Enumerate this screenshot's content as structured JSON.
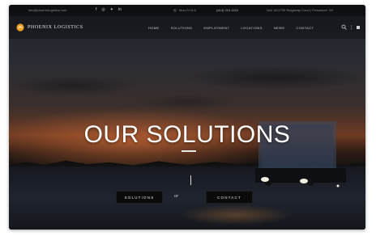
{
  "topbar": {
    "email": "info@phoenixlogistics.com",
    "social": [
      {
        "icon": "facebook-icon",
        "glyph": "f"
      },
      {
        "icon": "instagram-icon",
        "glyph": "◎"
      },
      {
        "icon": "twitter-icon",
        "glyph": "✦"
      },
      {
        "icon": "linkedin-icon",
        "glyph": "in"
      }
    ],
    "hours": "Mon-Fri 8-5",
    "phone": "(414) 210-1115",
    "address": "N44 W22755 Ridgeway Court | Pewaukee, WI"
  },
  "brand": {
    "name": "PHOENIX LOGISTICS",
    "mark_color": "#f0a020"
  },
  "nav": {
    "items": [
      "HOME",
      "SOLUTIONS",
      "EMPLOYMENT",
      "LOCATIONS",
      "NEWS",
      "CONTACT"
    ]
  },
  "hero": {
    "title": "OUR SOLUTIONS",
    "or_text": "or",
    "buttons": {
      "solutions": "SOLUTIONS",
      "contact": "CONTACT"
    }
  },
  "colors": {
    "accent": "#f0a020",
    "button_bg": "#0a0a0a",
    "title_text": "#ffffff"
  }
}
